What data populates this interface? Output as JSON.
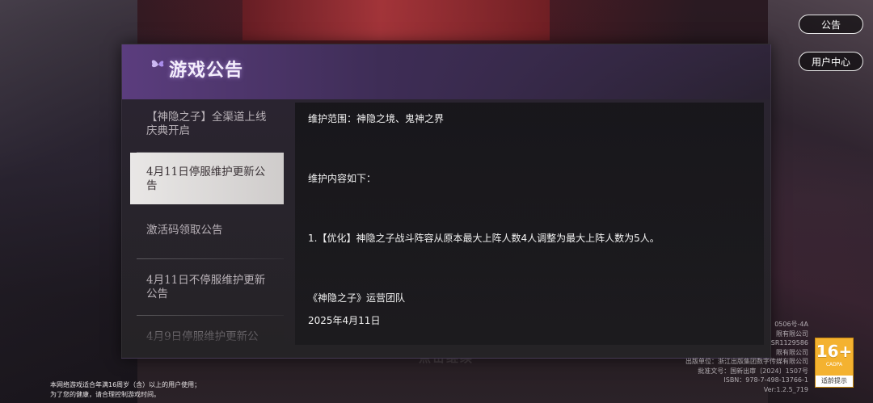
{
  "side_buttons": {
    "notice": "公告",
    "user_center": "用户中心"
  },
  "panel": {
    "title": "游戏公告",
    "tabs": [
      {
        "label": "【神隐之子】全渠道上线庆典开启"
      },
      {
        "label": "4月11日停服维护更新公告"
      },
      {
        "label": "激活码领取公告"
      },
      {
        "label": "4月11日不停服维护更新公告"
      },
      {
        "label": "4月9日停服维护更新公"
      }
    ],
    "selected_tab_index": 1,
    "content_lines": [
      "维护范围：神隐之境、鬼神之界",
      "维护内容如下：",
      "1.【优化】神隐之子战斗阵容从原本最大上阵人数4人调整为最大上阵人数为5人。",
      "《神隐之子》运营团队",
      "2025年4月11日"
    ]
  },
  "background_text": "点击继续",
  "legal": {
    "line1": "本网络游戏适合年满16周岁（含）以上的用户使用；",
    "line2": "为了您的健康，请合理控制游戏时间。"
  },
  "publishing_info": [
    "0506号-4A",
    "限有限公司",
    "SR1129586",
    "限有限公司",
    "出版单位：浙江出版集团数字传媒有限公司",
    "批准文号：国新出审〔2024〕1507号",
    "ISBN：978-7-498-13766-1",
    "Ver:1.2.5_719"
  ],
  "age_rating": {
    "age": "16+",
    "org": "CADPA",
    "tip": "适龄提示",
    "color": "#f4b230"
  },
  "colors": {
    "accent_purple": "#5b3d7e",
    "selected_tab_bg": "#e9e7e6"
  }
}
